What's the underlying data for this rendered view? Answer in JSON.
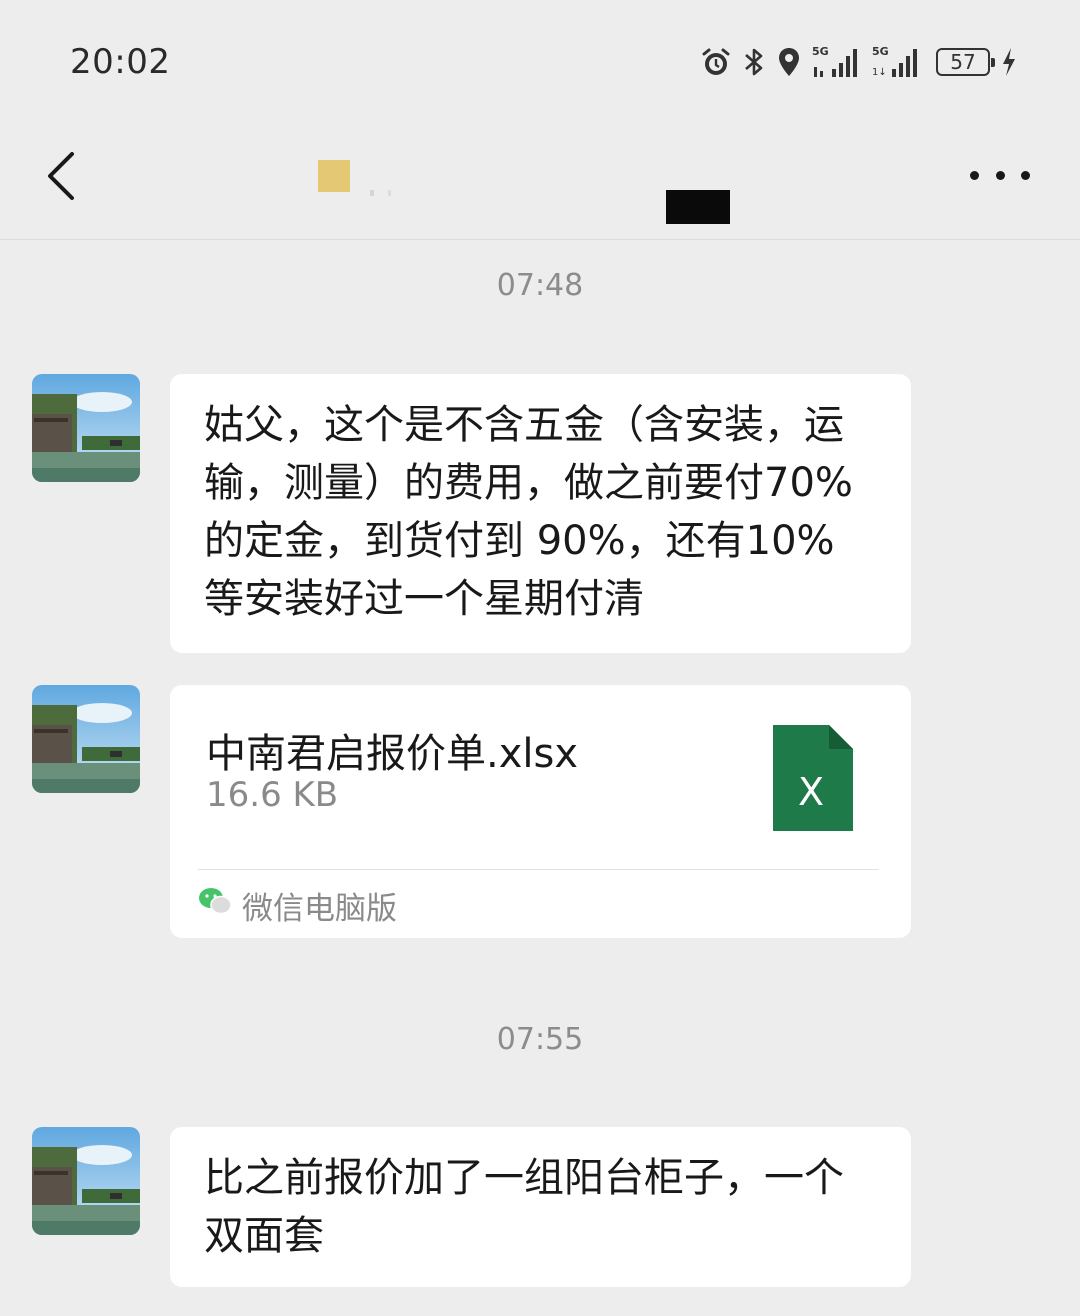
{
  "status_bar": {
    "time": "20:02",
    "battery": "57",
    "icons": [
      "alarm-icon",
      "bluetooth-icon",
      "location-icon",
      "signal-5g-icon",
      "signal-5g-icon",
      "battery-icon",
      "charging-icon"
    ],
    "network_label_1": "5G",
    "network_label_2": "5G"
  },
  "nav_bar": {
    "back_icon": "chevron-left-icon",
    "more_icon": "more-dots-icon",
    "title_accent": "#e5c874"
  },
  "chat": {
    "timestamps": [
      "07:48",
      "07:55"
    ],
    "messages": [
      {
        "type": "text",
        "text": "姑父，这个是不含五金（含安装，运输，测量）的费用，做之前要付70% 的定金，到货付到 90%，还有10% 等安装好过一个星期付清"
      },
      {
        "type": "file",
        "file_name": "中南君启报价单.xlsx",
        "file_size": "16.6 KB",
        "file_icon": "excel-file-icon",
        "file_icon_letter": "X",
        "file_icon_color": "#1f7a4a",
        "source": "微信电脑版"
      },
      {
        "type": "text",
        "text": "比之前报价加了一组阳台柜子，一个双面套"
      }
    ]
  },
  "colors": {
    "background": "#ededed",
    "bubble": "#ffffff",
    "text": "#191919",
    "meta_text": "#8c8c8c"
  }
}
